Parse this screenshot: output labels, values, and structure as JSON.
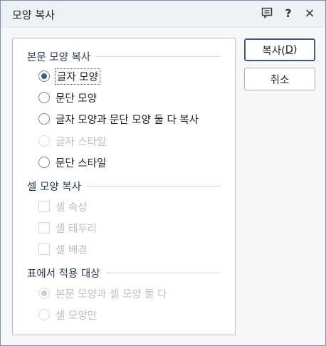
{
  "window": {
    "title": "모양 복사",
    "help_label": "?",
    "close_label": "×"
  },
  "icons": {
    "comment": "comment-icon",
    "help": "help-icon",
    "close": "close-icon"
  },
  "section_body": {
    "title": "본문 모양 복사",
    "options": [
      {
        "label": "글자 모양",
        "selected": true,
        "enabled": true
      },
      {
        "label": "문단 모양",
        "selected": false,
        "enabled": true
      },
      {
        "label": "글자 모양과 문단 모양 둘 다 복사",
        "selected": false,
        "enabled": true
      },
      {
        "label": "글자 스타일",
        "selected": false,
        "enabled": false
      },
      {
        "label": "문단 스타일",
        "selected": false,
        "enabled": true
      }
    ]
  },
  "section_cell": {
    "title": "셀 모양 복사",
    "options": [
      {
        "label": "셀 속성",
        "checked": false,
        "enabled": false
      },
      {
        "label": "셀 테두리",
        "checked": false,
        "enabled": false
      },
      {
        "label": "셀 배경",
        "checked": false,
        "enabled": false
      }
    ]
  },
  "section_table": {
    "title": "표에서 적용 대상",
    "options": [
      {
        "label": "본문 모양과 셀 모양 둘 다",
        "selected": true,
        "enabled": false
      },
      {
        "label": "셀 모양만",
        "selected": false,
        "enabled": false
      }
    ]
  },
  "buttons": {
    "copy_prefix": "복사(",
    "copy_accel": "D",
    "copy_suffix": ")",
    "cancel": "취소"
  },
  "colors": {
    "accent": "#3e5b8f",
    "disabled": "#b9bec7"
  }
}
